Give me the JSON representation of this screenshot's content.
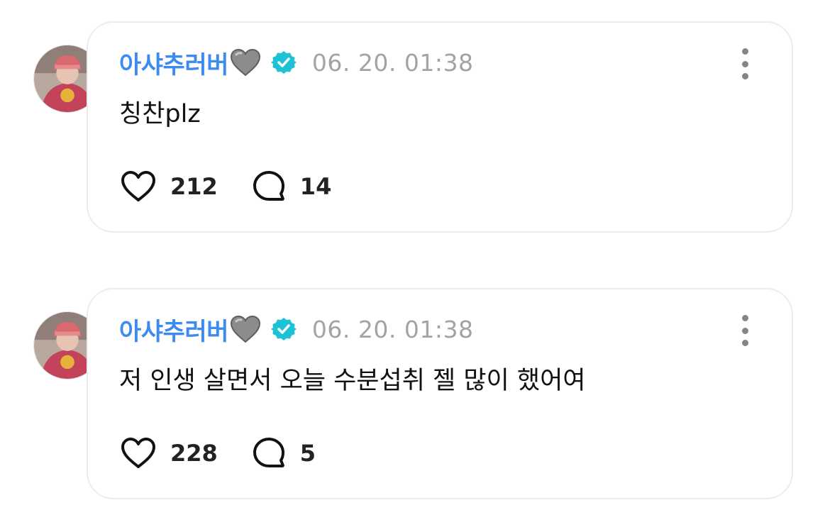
{
  "posts": [
    {
      "author": "아샤추러버",
      "author_emoji": "grey-heart-icon",
      "verified": true,
      "timestamp": "06. 20. 01:38",
      "text": "칭찬plz",
      "likes": "212",
      "comments": "14"
    },
    {
      "author": "아샤추러버",
      "author_emoji": "grey-heart-icon",
      "verified": true,
      "timestamp": "06. 20. 01:38",
      "text": "저 인생 살면서 오늘 수분섭취 젤 많이 했어여",
      "likes": "228",
      "comments": "5"
    }
  ],
  "colors": {
    "author": "#3d8bf0",
    "verified_badge": "#1ec2d6",
    "timestamp": "#a3a3a3",
    "card_border": "#ececec"
  },
  "icons": {
    "like": "heart-outline-icon",
    "comment": "speech-bubble-icon",
    "more": "more-vertical-icon",
    "verified": "verified-badge-icon"
  }
}
